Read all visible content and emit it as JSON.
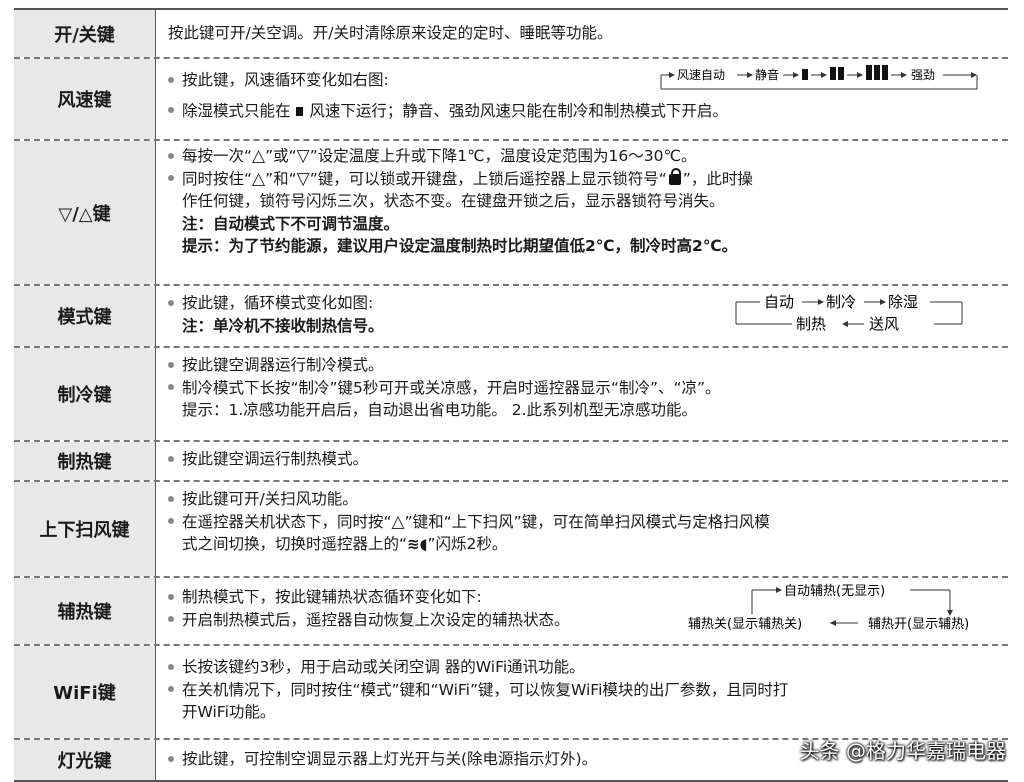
{
  "rows": [
    {
      "key": "开/关键",
      "lines": [
        "按此键可开/关空调。开/关时清除原来设定的定时、睡眠等功能。"
      ]
    },
    {
      "key": "风速键",
      "lines": [
        "按此键，风速循环变化如右图:",
        "除湿模式只能在",
        "风速下运行；静音、强劲风速只能在制冷和制热模式下开启。"
      ],
      "diagram": [
        "风速自动",
        "静音",
        "强劲"
      ]
    },
    {
      "key": "▽/△键",
      "lines": [
        "每按一次“",
        "”或“",
        "”设定温度上升或下降1℃，温度设定范围为16～30℃。",
        "同时按住“",
        "”和“",
        "”键，可以锁或开键盘，上锁后遥控器上显示锁符号“",
        "”，此时操",
        "作任何键，锁符号闪烁三次，状态不变。在键盘开锁之后，显示器锁符号消失。",
        "注：自动模式下不可调节温度。",
        "提示：为了节约能源，建议用户设定温度制热时比期望值低2℃，制冷时高2℃。"
      ]
    },
    {
      "key": "模式键",
      "lines": [
        "按此键，循环模式变化如图:",
        "注：单冷机不接收制热信号。"
      ],
      "diagram": [
        "自动",
        "制冷",
        "除湿",
        "制热",
        "送风"
      ]
    },
    {
      "key": "制冷键",
      "lines": [
        "按此键空调器运行制冷模式。",
        "制冷模式下长按“制冷”键5秒可开或关凉感，开启时遥控器显示“制冷”、“凉”。",
        "提示：1.凉感功能开启后，自动退出省电功能。    2.此系列机型无凉感功能。"
      ]
    },
    {
      "key": "制热键",
      "lines": [
        "按此键空调运行制热模式。"
      ]
    },
    {
      "key": "上下扫风键",
      "lines": [
        "按此键可开/关扫风功能。",
        "在遥控器关机状态下，同时按“",
        "”键和“上下扫风”键，可在简单扫风模式与定格扫风模",
        "式之间切换，切换时遥控器上的“",
        "”闪烁2秒。"
      ]
    },
    {
      "key": "辅热键",
      "lines": [
        "制热模式下，按此键辅热状态循环变化如下:",
        "开启制热模式后，遥控器自动恢复上次设定的辅热状态。"
      ],
      "diagram": [
        "自动辅热(无显示)",
        "辅热关(显示辅热关)",
        "辅热开(显示辅热)"
      ]
    },
    {
      "key": "WiFi键",
      "lines": [
        "长按该键约3秒，用于启动或关闭空调  器的WiFi通讯功能。",
        "在关机情况下，同时按住“模式”键和“WiFi”键，可以恢复WiFi模块的出厂参数，且同时打",
        "开WiFi功能。"
      ]
    },
    {
      "key": "灯光键",
      "lines": [
        "按此键，可控制空调显示器上灯光开与关(除电源指示灯外)。"
      ]
    }
  ],
  "symbols": {
    "up": "△",
    "down": "▽"
  },
  "watermark": "头条 @格力华嘉瑞电器"
}
